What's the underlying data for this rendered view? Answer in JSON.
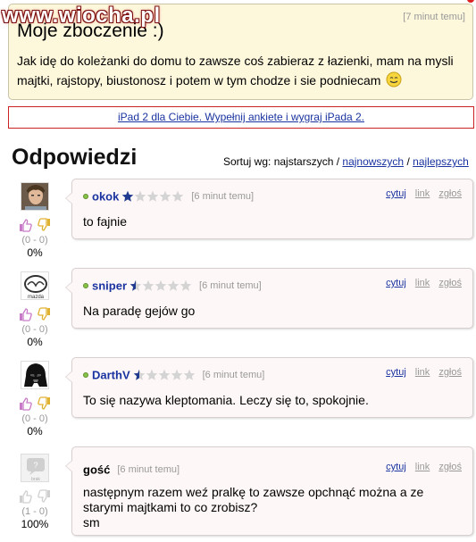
{
  "watermark": "www.wiocha.pl",
  "question": {
    "time": "[7 minut temu]",
    "title": "Moje zboczenie :)",
    "body": "Jak idę do koleżanki do domu to zawsze coś zabieraz z łazienki, mam na mysli majtki, rajstopy, biustonosz i potem w tym chodze i sie podniecam"
  },
  "promo": {
    "text": "iPad 2 dla Ciebie. Wypełnij ankiete i wygraj iPada 2."
  },
  "answers_heading": "Odpowiedzi",
  "sort": {
    "label": "Sortuj wg: najstarszych /",
    "newest": "najnowszych",
    "separator": "/",
    "best": "najlepszych"
  },
  "colors": {
    "link": "#1a33a0",
    "star_filled": "#1f3a8f",
    "star_empty": "#d4d4d4"
  },
  "answers": [
    {
      "author": "okok",
      "online": true,
      "rating": 1,
      "time": "[6 minut temu]",
      "text": "to fajnie",
      "votes": "(0 - 0)",
      "percent": "0%",
      "avatar": "photo-avatar",
      "actions": {
        "quote": "cytuj",
        "link": "link",
        "report": "zgłoś"
      }
    },
    {
      "author": "sniper",
      "online": true,
      "rating": 0.5,
      "time": "[6 minut temu]",
      "text": "Na paradę gejów go",
      "votes": "(0 - 0)",
      "percent": "0%",
      "avatar": "mazda-logo-avatar",
      "actions": {
        "quote": "cytuj",
        "link": "link",
        "report": "zgłoś"
      }
    },
    {
      "author": "DarthV",
      "online": true,
      "rating": 0.5,
      "time": "[6 minut temu]",
      "text": "To się nazywa kleptomania. Leczy się to, spokojnie.",
      "votes": "(0 - 0)",
      "percent": "0%",
      "avatar": "darth-vader-avatar",
      "actions": {
        "quote": "cytuj",
        "link": "link",
        "report": "zgłoś"
      }
    },
    {
      "author": "gość",
      "online": false,
      "rating": null,
      "time": "[6 minut temu]",
      "text": "następnym razem weź pralkę to zawsze opchnąć można a ze starymi majtkami to co zrobisz?\nsm",
      "votes": "(1 - 0)",
      "percent": "100%",
      "avatar": "guest-avatar",
      "actions": {
        "quote": "cytuj",
        "link": "link",
        "report": "zgłoś"
      }
    }
  ]
}
